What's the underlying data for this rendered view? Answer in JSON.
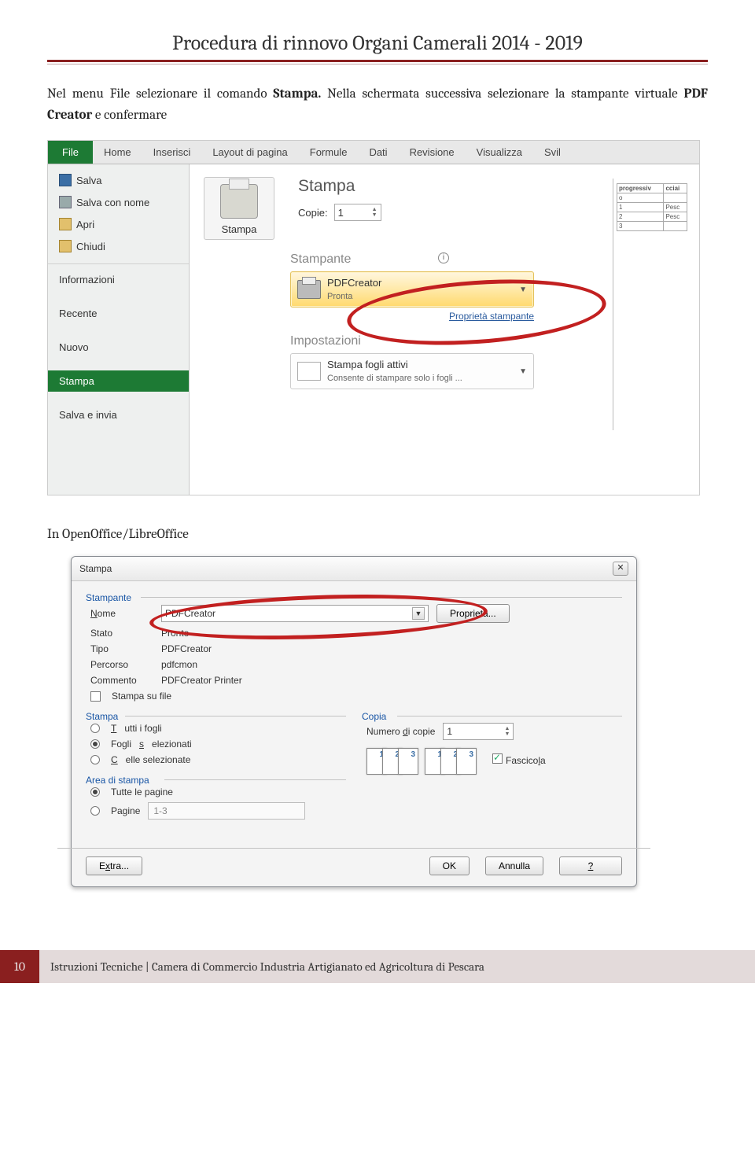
{
  "document": {
    "title": "Procedura di rinnovo Organi Camerali 2014 - 2019",
    "paragraph1_a": "Nel menu File selezionare il comando ",
    "paragraph1_b": "Stampa.",
    "paragraph1_c": " Nella schermata successiva selezionare la stampante virtuale ",
    "paragraph1_d": "PDF Creator",
    "paragraph1_e": " e confermare",
    "mid_text": "In OpenOffice/LibreOffice",
    "footer_page": "10",
    "footer_text": "Istruzioni Tecniche | Camera di Commercio Industria Artigianato ed Agricoltura di Pescara"
  },
  "excel": {
    "tabs": [
      "File",
      "Home",
      "Inserisci",
      "Layout di pagina",
      "Formule",
      "Dati",
      "Revisione",
      "Visualizza",
      "Svil"
    ],
    "sidebar": {
      "salva": "Salva",
      "salvacon": "Salva con nome",
      "apri": "Apri",
      "chiudi": "Chiudi",
      "informazioni": "Informazioni",
      "recente": "Recente",
      "nuovo": "Nuovo",
      "stampa": "Stampa",
      "salvainvia": "Salva e invia"
    },
    "print": {
      "heading": "Stampa",
      "copies_label": "Copie:",
      "copies_value": "1",
      "print_btn": "Stampa",
      "section_stampante": "Stampante",
      "printer_name": "PDFCreator",
      "printer_status": "Pronta",
      "printer_props": "Proprietà stampante",
      "section_impostazioni": "Impostazioni",
      "setting_title": "Stampa fogli attivi",
      "setting_sub": "Consente di stampare solo i fogli ..."
    },
    "preview": {
      "h1": "progressiv",
      "h1b": "o",
      "h2": "cciai",
      "r1a": "1",
      "r1b": "Pesc",
      "r2a": "2",
      "r2b": "Pesc",
      "r3a": "3",
      "r3b": ""
    }
  },
  "openoffice": {
    "title": "Stampa",
    "close": "✕",
    "stampante": {
      "legend": "Stampante",
      "nome_lbl": "Nome",
      "nome_val": "PDFCreator",
      "prop_btn": "Proprietà...",
      "stato_lbl": "Stato",
      "stato_val": "Pronto",
      "tipo_lbl": "Tipo",
      "tipo_val": "PDFCreator",
      "percorso_lbl": "Percorso",
      "percorso_val": "pdfcmon",
      "commento_lbl": "Commento",
      "commento_val": "PDFCreator Printer",
      "stampa_file": "Stampa su file"
    },
    "stampa": {
      "legend": "Stampa",
      "tutti": "Tutti i fogli",
      "fogli_sel": "Fogli selezionati",
      "celle_sel": "Celle selezionate"
    },
    "copia": {
      "legend": "Copia",
      "num_lbl": "Numero di copie",
      "num_val": "1",
      "fascicola": "Fascicola"
    },
    "area": {
      "legend": "Area di stampa",
      "tutte": "Tutte le pagine",
      "pagine": "Pagine",
      "pagine_val": "1-3"
    },
    "buttons": {
      "extra": "Extra...",
      "ok": "OK",
      "annulla": "Annulla",
      "help": "?"
    }
  }
}
